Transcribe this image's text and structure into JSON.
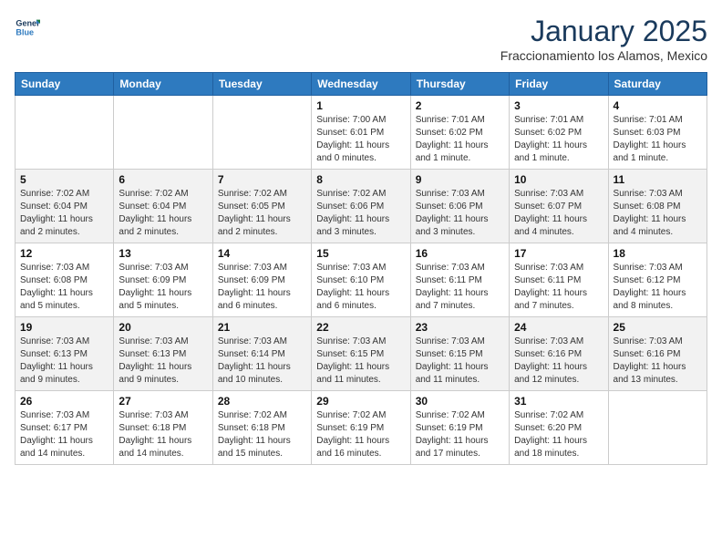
{
  "header": {
    "logo_general": "General",
    "logo_blue": "Blue",
    "month_title": "January 2025",
    "location": "Fraccionamiento los Alamos, Mexico"
  },
  "weekdays": [
    "Sunday",
    "Monday",
    "Tuesday",
    "Wednesday",
    "Thursday",
    "Friday",
    "Saturday"
  ],
  "weeks": [
    [
      {
        "day": "",
        "info": ""
      },
      {
        "day": "",
        "info": ""
      },
      {
        "day": "",
        "info": ""
      },
      {
        "day": "1",
        "info": "Sunrise: 7:00 AM\nSunset: 6:01 PM\nDaylight: 11 hours\nand 0 minutes."
      },
      {
        "day": "2",
        "info": "Sunrise: 7:01 AM\nSunset: 6:02 PM\nDaylight: 11 hours\nand 1 minute."
      },
      {
        "day": "3",
        "info": "Sunrise: 7:01 AM\nSunset: 6:02 PM\nDaylight: 11 hours\nand 1 minute."
      },
      {
        "day": "4",
        "info": "Sunrise: 7:01 AM\nSunset: 6:03 PM\nDaylight: 11 hours\nand 1 minute."
      }
    ],
    [
      {
        "day": "5",
        "info": "Sunrise: 7:02 AM\nSunset: 6:04 PM\nDaylight: 11 hours\nand 2 minutes."
      },
      {
        "day": "6",
        "info": "Sunrise: 7:02 AM\nSunset: 6:04 PM\nDaylight: 11 hours\nand 2 minutes."
      },
      {
        "day": "7",
        "info": "Sunrise: 7:02 AM\nSunset: 6:05 PM\nDaylight: 11 hours\nand 2 minutes."
      },
      {
        "day": "8",
        "info": "Sunrise: 7:02 AM\nSunset: 6:06 PM\nDaylight: 11 hours\nand 3 minutes."
      },
      {
        "day": "9",
        "info": "Sunrise: 7:03 AM\nSunset: 6:06 PM\nDaylight: 11 hours\nand 3 minutes."
      },
      {
        "day": "10",
        "info": "Sunrise: 7:03 AM\nSunset: 6:07 PM\nDaylight: 11 hours\nand 4 minutes."
      },
      {
        "day": "11",
        "info": "Sunrise: 7:03 AM\nSunset: 6:08 PM\nDaylight: 11 hours\nand 4 minutes."
      }
    ],
    [
      {
        "day": "12",
        "info": "Sunrise: 7:03 AM\nSunset: 6:08 PM\nDaylight: 11 hours\nand 5 minutes."
      },
      {
        "day": "13",
        "info": "Sunrise: 7:03 AM\nSunset: 6:09 PM\nDaylight: 11 hours\nand 5 minutes."
      },
      {
        "day": "14",
        "info": "Sunrise: 7:03 AM\nSunset: 6:09 PM\nDaylight: 11 hours\nand 6 minutes."
      },
      {
        "day": "15",
        "info": "Sunrise: 7:03 AM\nSunset: 6:10 PM\nDaylight: 11 hours\nand 6 minutes."
      },
      {
        "day": "16",
        "info": "Sunrise: 7:03 AM\nSunset: 6:11 PM\nDaylight: 11 hours\nand 7 minutes."
      },
      {
        "day": "17",
        "info": "Sunrise: 7:03 AM\nSunset: 6:11 PM\nDaylight: 11 hours\nand 7 minutes."
      },
      {
        "day": "18",
        "info": "Sunrise: 7:03 AM\nSunset: 6:12 PM\nDaylight: 11 hours\nand 8 minutes."
      }
    ],
    [
      {
        "day": "19",
        "info": "Sunrise: 7:03 AM\nSunset: 6:13 PM\nDaylight: 11 hours\nand 9 minutes."
      },
      {
        "day": "20",
        "info": "Sunrise: 7:03 AM\nSunset: 6:13 PM\nDaylight: 11 hours\nand 9 minutes."
      },
      {
        "day": "21",
        "info": "Sunrise: 7:03 AM\nSunset: 6:14 PM\nDaylight: 11 hours\nand 10 minutes."
      },
      {
        "day": "22",
        "info": "Sunrise: 7:03 AM\nSunset: 6:15 PM\nDaylight: 11 hours\nand 11 minutes."
      },
      {
        "day": "23",
        "info": "Sunrise: 7:03 AM\nSunset: 6:15 PM\nDaylight: 11 hours\nand 11 minutes."
      },
      {
        "day": "24",
        "info": "Sunrise: 7:03 AM\nSunset: 6:16 PM\nDaylight: 11 hours\nand 12 minutes."
      },
      {
        "day": "25",
        "info": "Sunrise: 7:03 AM\nSunset: 6:16 PM\nDaylight: 11 hours\nand 13 minutes."
      }
    ],
    [
      {
        "day": "26",
        "info": "Sunrise: 7:03 AM\nSunset: 6:17 PM\nDaylight: 11 hours\nand 14 minutes."
      },
      {
        "day": "27",
        "info": "Sunrise: 7:03 AM\nSunset: 6:18 PM\nDaylight: 11 hours\nand 14 minutes."
      },
      {
        "day": "28",
        "info": "Sunrise: 7:02 AM\nSunset: 6:18 PM\nDaylight: 11 hours\nand 15 minutes."
      },
      {
        "day": "29",
        "info": "Sunrise: 7:02 AM\nSunset: 6:19 PM\nDaylight: 11 hours\nand 16 minutes."
      },
      {
        "day": "30",
        "info": "Sunrise: 7:02 AM\nSunset: 6:19 PM\nDaylight: 11 hours\nand 17 minutes."
      },
      {
        "day": "31",
        "info": "Sunrise: 7:02 AM\nSunset: 6:20 PM\nDaylight: 11 hours\nand 18 minutes."
      },
      {
        "day": "",
        "info": ""
      }
    ]
  ]
}
